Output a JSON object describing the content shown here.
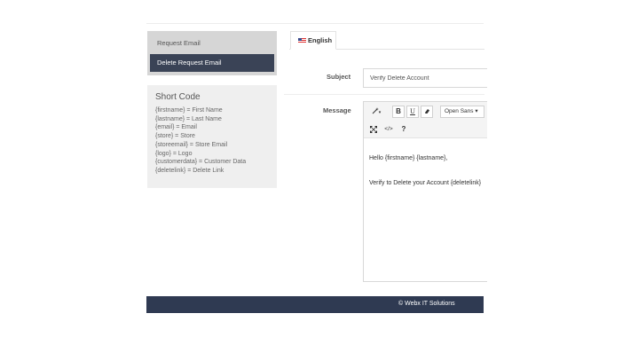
{
  "sidebar": {
    "items": [
      {
        "label": "Request Email",
        "active": false
      },
      {
        "label": "Delete Request Email",
        "active": true
      }
    ]
  },
  "shortcode": {
    "title": "Short Code",
    "codes": [
      "{firstname} = First Name",
      "{lastname} = Last Name",
      "{email} = Email",
      "{store} = Store",
      "{storeemail} = Store Email",
      "{logo} = Logo",
      "{customerdata} = Customer Data",
      "{deletelink} = Delete Link"
    ]
  },
  "tabs": [
    {
      "label": "English",
      "icon": "uk-flag-icon"
    }
  ],
  "form": {
    "subject_label": "Subject",
    "subject_value": "Verify Delete Account",
    "message_label": "Message"
  },
  "editor": {
    "toolbar": {
      "magic": "▾",
      "bold": "B",
      "underline": "U",
      "eraser": "⌫",
      "font": "Open Sans ▾",
      "fullscreen": "⤧",
      "code": "</>",
      "help": "?"
    },
    "body_lines": [
      "Hello {firstname} {lastname},",
      "Verify to Delete your Account {deletelink}"
    ]
  },
  "footer": {
    "text": "© Webx IT Solutions"
  },
  "colors": {
    "dark_navy": "#2f3a52",
    "active_item": "#3a4356",
    "panel_grey": "#efefef"
  }
}
